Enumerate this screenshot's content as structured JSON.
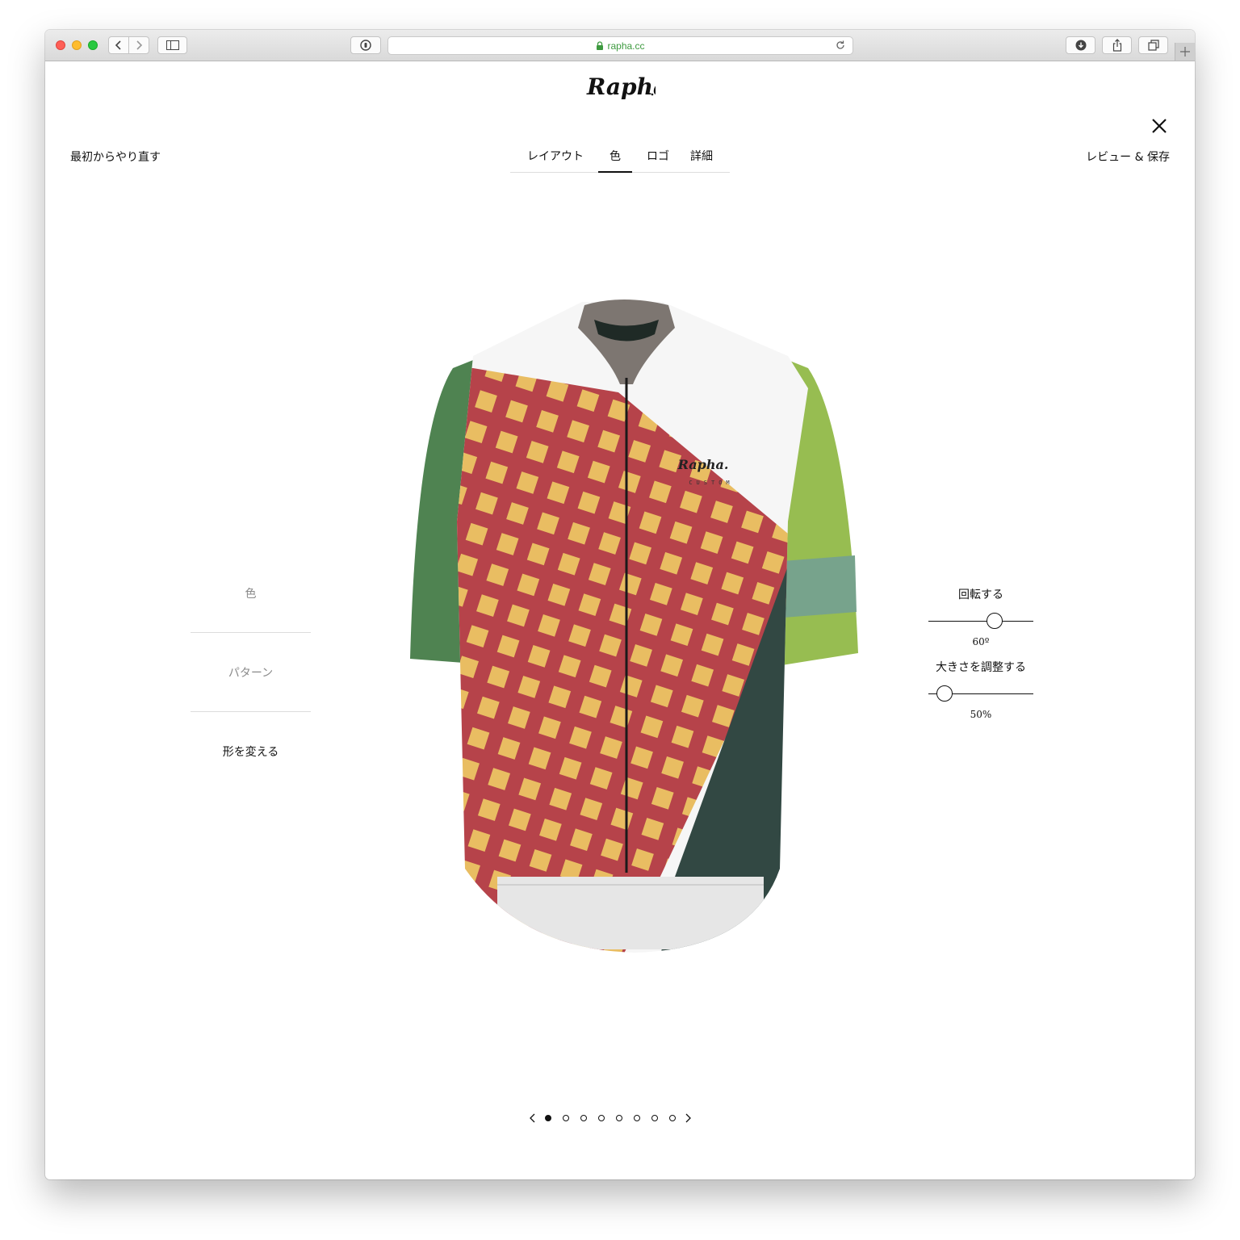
{
  "browser": {
    "url": "rapha.cc",
    "icons": [
      "back-icon",
      "forward-icon",
      "sidebar-icon",
      "password-icon",
      "lock-icon",
      "reload-icon",
      "download-icon",
      "share-icon",
      "tabs-icon",
      "new-tab-icon"
    ]
  },
  "header": {
    "brand": "Rapha",
    "restart_label": "最初からやり直す",
    "review_label": "レビュー & 保存",
    "tabs": [
      {
        "label": "レイアウト",
        "active": false
      },
      {
        "label": "色",
        "active": true
      },
      {
        "label": "ロゴ",
        "active": false
      },
      {
        "label": "詳細",
        "active": false
      }
    ]
  },
  "left_panel": {
    "items": [
      {
        "label": "色",
        "active": false
      },
      {
        "label": "パターン",
        "active": false
      },
      {
        "label": "形を変える",
        "active": true
      }
    ]
  },
  "controls": {
    "rotate": {
      "label": "回転する",
      "value": "60º",
      "level": 0.63
    },
    "scale": {
      "label": "大きさを調整する",
      "value": "50%",
      "level": 0.15
    }
  },
  "jersey": {
    "brand_mark": "Rapha.",
    "sub_mark": "CUSTOM",
    "colors": {
      "body_white": "#f6f6f6",
      "pattern_red": "#b6434a",
      "pattern_yellow": "#e9bd62",
      "dark_panel": "#324843",
      "sleeve_left": "#4f8351",
      "sleeve_right": "#97bd51",
      "sleeve_band": "#77a38c",
      "collar": "#7d7671",
      "hem": "#1f2a26"
    }
  },
  "pager": {
    "count": 8,
    "active_index": 0
  }
}
